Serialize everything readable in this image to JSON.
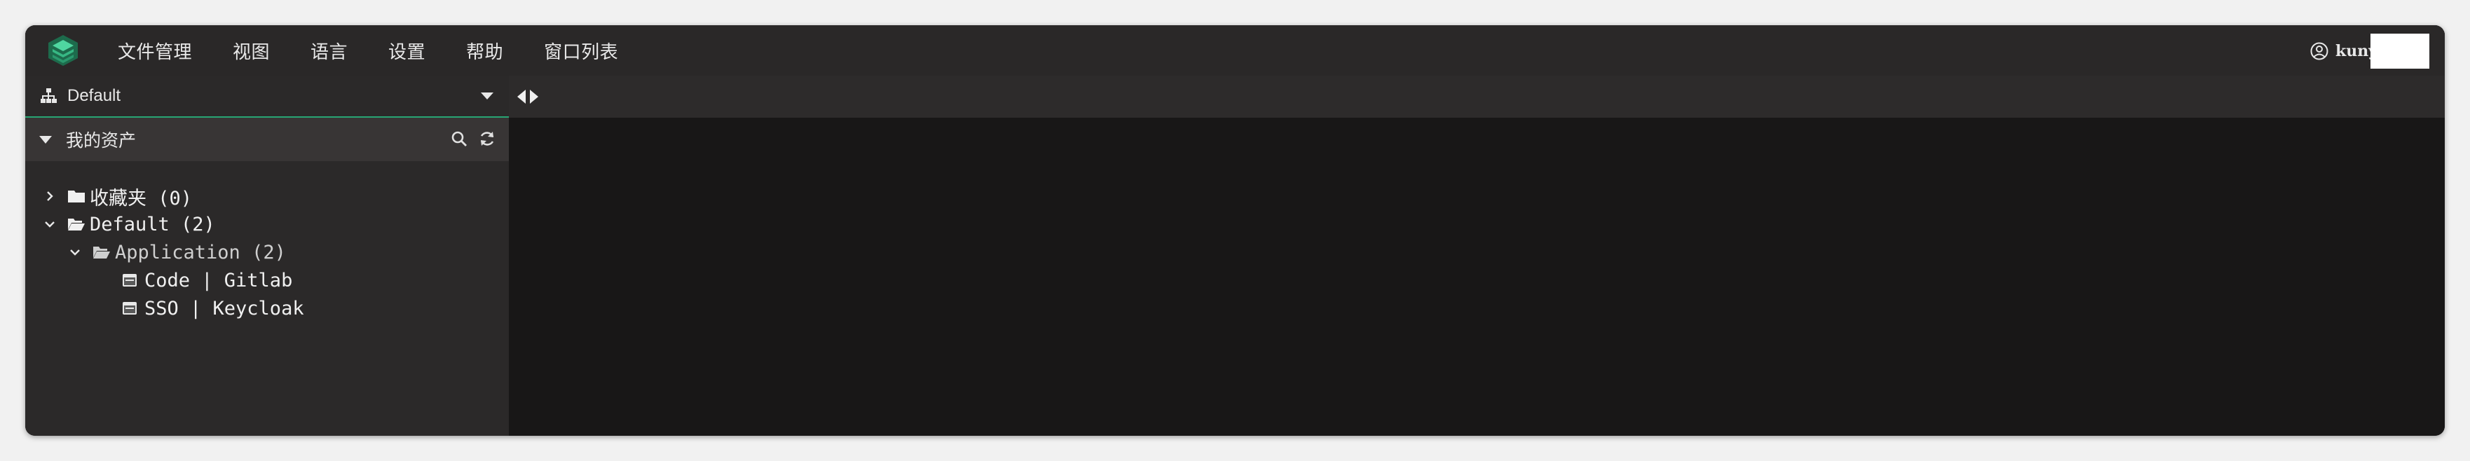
{
  "menubar": {
    "items": [
      "文件管理",
      "视图",
      "语言",
      "设置",
      "帮助",
      "窗口列表"
    ],
    "user_name": "kuny"
  },
  "sidebar": {
    "selector_label": "Default",
    "assets_title": "我的资产",
    "tree": [
      {
        "label": "收藏夹 (0)",
        "type": "folder",
        "expanded": false
      },
      {
        "label": "Default (2)",
        "type": "folder-open",
        "expanded": true
      },
      {
        "label": "Application (2)",
        "type": "folder-open",
        "expanded": true
      },
      {
        "label": "Code | Gitlab",
        "type": "app"
      },
      {
        "label": "SSO | Keycloak",
        "type": "app"
      }
    ]
  },
  "colors": {
    "accent": "#27a574",
    "window_bg": "#1c1b1b",
    "menubar_bg": "#2a2828",
    "sidebar_bg": "#2b2929"
  },
  "icons": [
    "logo-icon",
    "user-circle-icon",
    "sitemap-icon",
    "caret-down-icon",
    "search-icon",
    "refresh-icon",
    "folder-icon",
    "folder-open-icon",
    "app-icon",
    "chevron-right-icon",
    "chevron-down-icon",
    "arrow-left-icon",
    "arrow-right-icon"
  ]
}
